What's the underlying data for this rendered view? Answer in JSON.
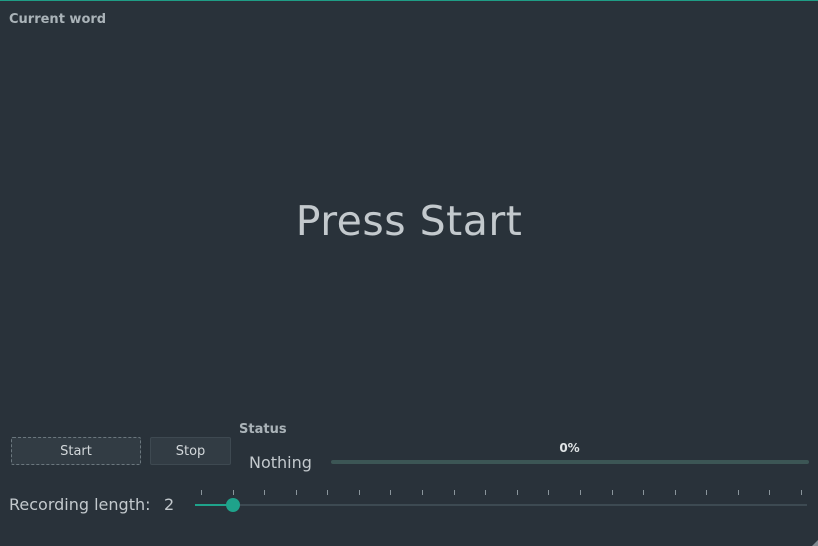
{
  "current_word": {
    "title": "Current word",
    "word": "Press Start"
  },
  "controls": {
    "start_label": "Start",
    "stop_label": "Stop"
  },
  "status": {
    "title": "Status",
    "text": "Nothing",
    "progress_label": "0%",
    "progress_value": 0
  },
  "recording": {
    "label": "Recording length:",
    "value": "2",
    "slider_min": 1,
    "slider_max": 20,
    "slider_value": 2
  },
  "colors": {
    "accent": "#1fa38b",
    "background": "#29323a"
  }
}
